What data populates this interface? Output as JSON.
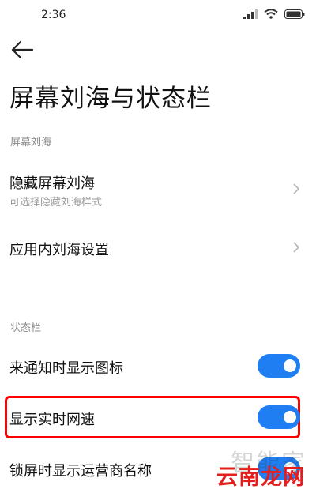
{
  "status_bar": {
    "time": "2:36"
  },
  "header": {
    "title": "屏幕刘海与状态栏"
  },
  "sections": {
    "notch": {
      "title": "屏幕刘海",
      "hide_notch": {
        "title": "隐藏屏幕刘海",
        "subtitle": "可选择隐藏刘海样式"
      },
      "in_app_notch": {
        "title": "应用内刘海设置"
      }
    },
    "status_bar": {
      "title": "状态栏",
      "notification_icons": {
        "title": "来通知时显示图标",
        "on": true
      },
      "realtime_speed": {
        "title": "显示实时网速",
        "on": true
      },
      "carrier_name": {
        "title": "锁屏时显示运营商名称",
        "on": true
      }
    }
  },
  "watermark": {
    "faint": "智能家",
    "main": "云南龙网"
  },
  "colors": {
    "accent": "#1e7ef2",
    "highlight": "#ff0000",
    "watermark": "#e41d1d"
  }
}
